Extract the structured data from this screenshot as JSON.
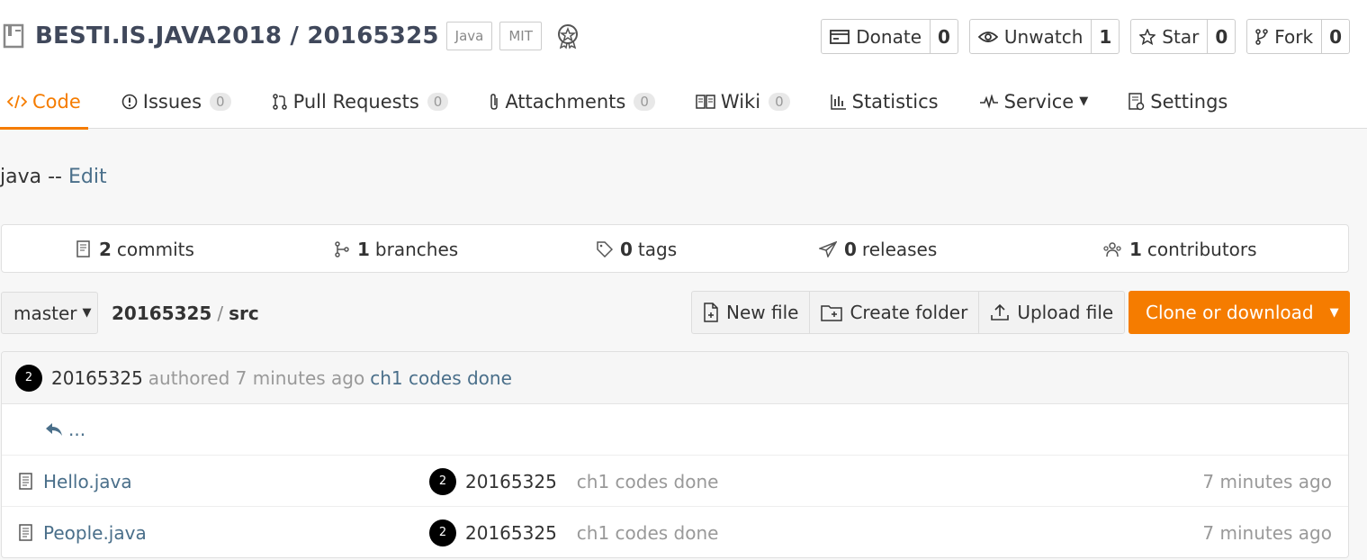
{
  "repo": {
    "name": "BESTI.IS.JAVA2018 / 20165325",
    "badges": [
      "Java",
      "MIT"
    ]
  },
  "actions": [
    {
      "label": "Donate",
      "count": "0",
      "icon": "donate-icon"
    },
    {
      "label": "Unwatch",
      "count": "1",
      "icon": "eye-icon"
    },
    {
      "label": "Star",
      "count": "0",
      "icon": "star-icon"
    },
    {
      "label": "Fork",
      "count": "0",
      "icon": "fork-icon"
    }
  ],
  "nav": [
    {
      "label": "Code",
      "badge": null,
      "active": true
    },
    {
      "label": "Issues",
      "badge": "0"
    },
    {
      "label": "Pull Requests",
      "badge": "0"
    },
    {
      "label": "Attachments",
      "badge": "0"
    },
    {
      "label": "Wiki",
      "badge": "0"
    },
    {
      "label": "Statistics",
      "badge": null
    },
    {
      "label": "Service",
      "badge": null
    },
    {
      "label": "Settings",
      "badge": null
    }
  ],
  "description": {
    "text": "java -- ",
    "edit_label": "Edit"
  },
  "stats": {
    "commits": {
      "count": "2",
      "label": "commits"
    },
    "branches": {
      "count": "1",
      "label": "branches"
    },
    "tags": {
      "count": "0",
      "label": "tags"
    },
    "releases": {
      "count": "0",
      "label": "releases"
    },
    "contributors": {
      "count": "1",
      "label": "contributors"
    }
  },
  "toolbar": {
    "branch": "master",
    "path_root": "20165325",
    "path_sep": "/",
    "path_current": "src",
    "new_file": "New file",
    "create_folder": "Create folder",
    "upload_file": "Upload file",
    "clone": "Clone or download"
  },
  "latest_commit": {
    "avatar": "2",
    "author": "20165325",
    "authored": "authored 7 minutes ago",
    "message": "ch1 codes done"
  },
  "back_label": "...",
  "files": [
    {
      "name": "Hello.java",
      "avatar": "2",
      "author": "20165325",
      "message": "ch1 codes done",
      "time": "7 minutes ago"
    },
    {
      "name": "People.java",
      "avatar": "2",
      "author": "20165325",
      "message": "ch1 codes done",
      "time": "7 minutes ago"
    }
  ],
  "colors": {
    "accent": "#f57c00",
    "link": "#4a6f8a"
  }
}
